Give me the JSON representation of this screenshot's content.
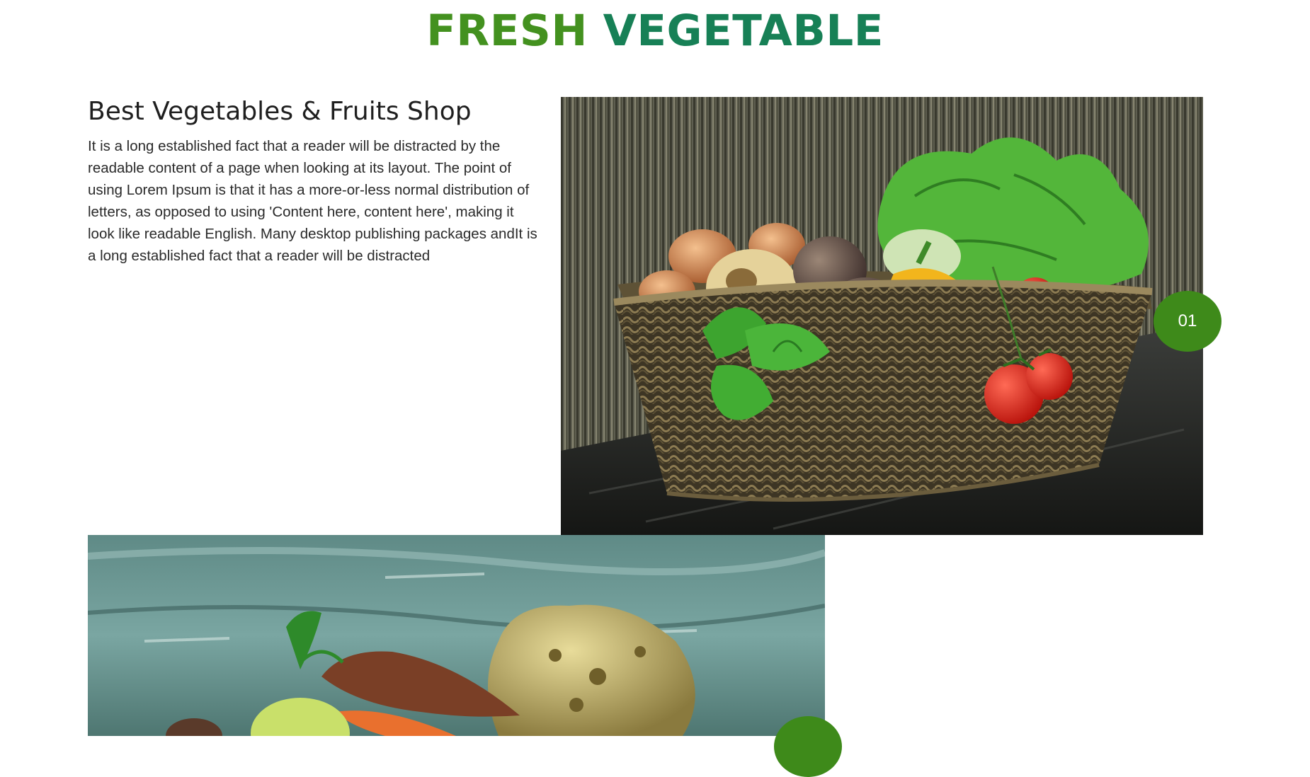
{
  "header": {
    "title_word_1": "FRESH",
    "title_word_2": "VEGETABLE"
  },
  "section": {
    "heading": "Best Vegetables & Fruits Shop",
    "paragraph": "It is a long established fact that a reader will be distracted by the readable content of a page when looking at its layout. The point of using Lorem Ipsum is that it has a more-or-less normal distribution of letters, as opposed to using 'Content here, content here', making it look like readable English. Many desktop publishing packages andIt is a long established fact that a reader will be distracted"
  },
  "items": [
    {
      "number": "01",
      "image": "vegetable-basket-photo"
    },
    {
      "number": "",
      "image": "root-vegetables-photo"
    }
  ],
  "colors": {
    "title_green": "#43911f",
    "title_teal": "#178056",
    "badge_green": "#3e8a1a"
  }
}
